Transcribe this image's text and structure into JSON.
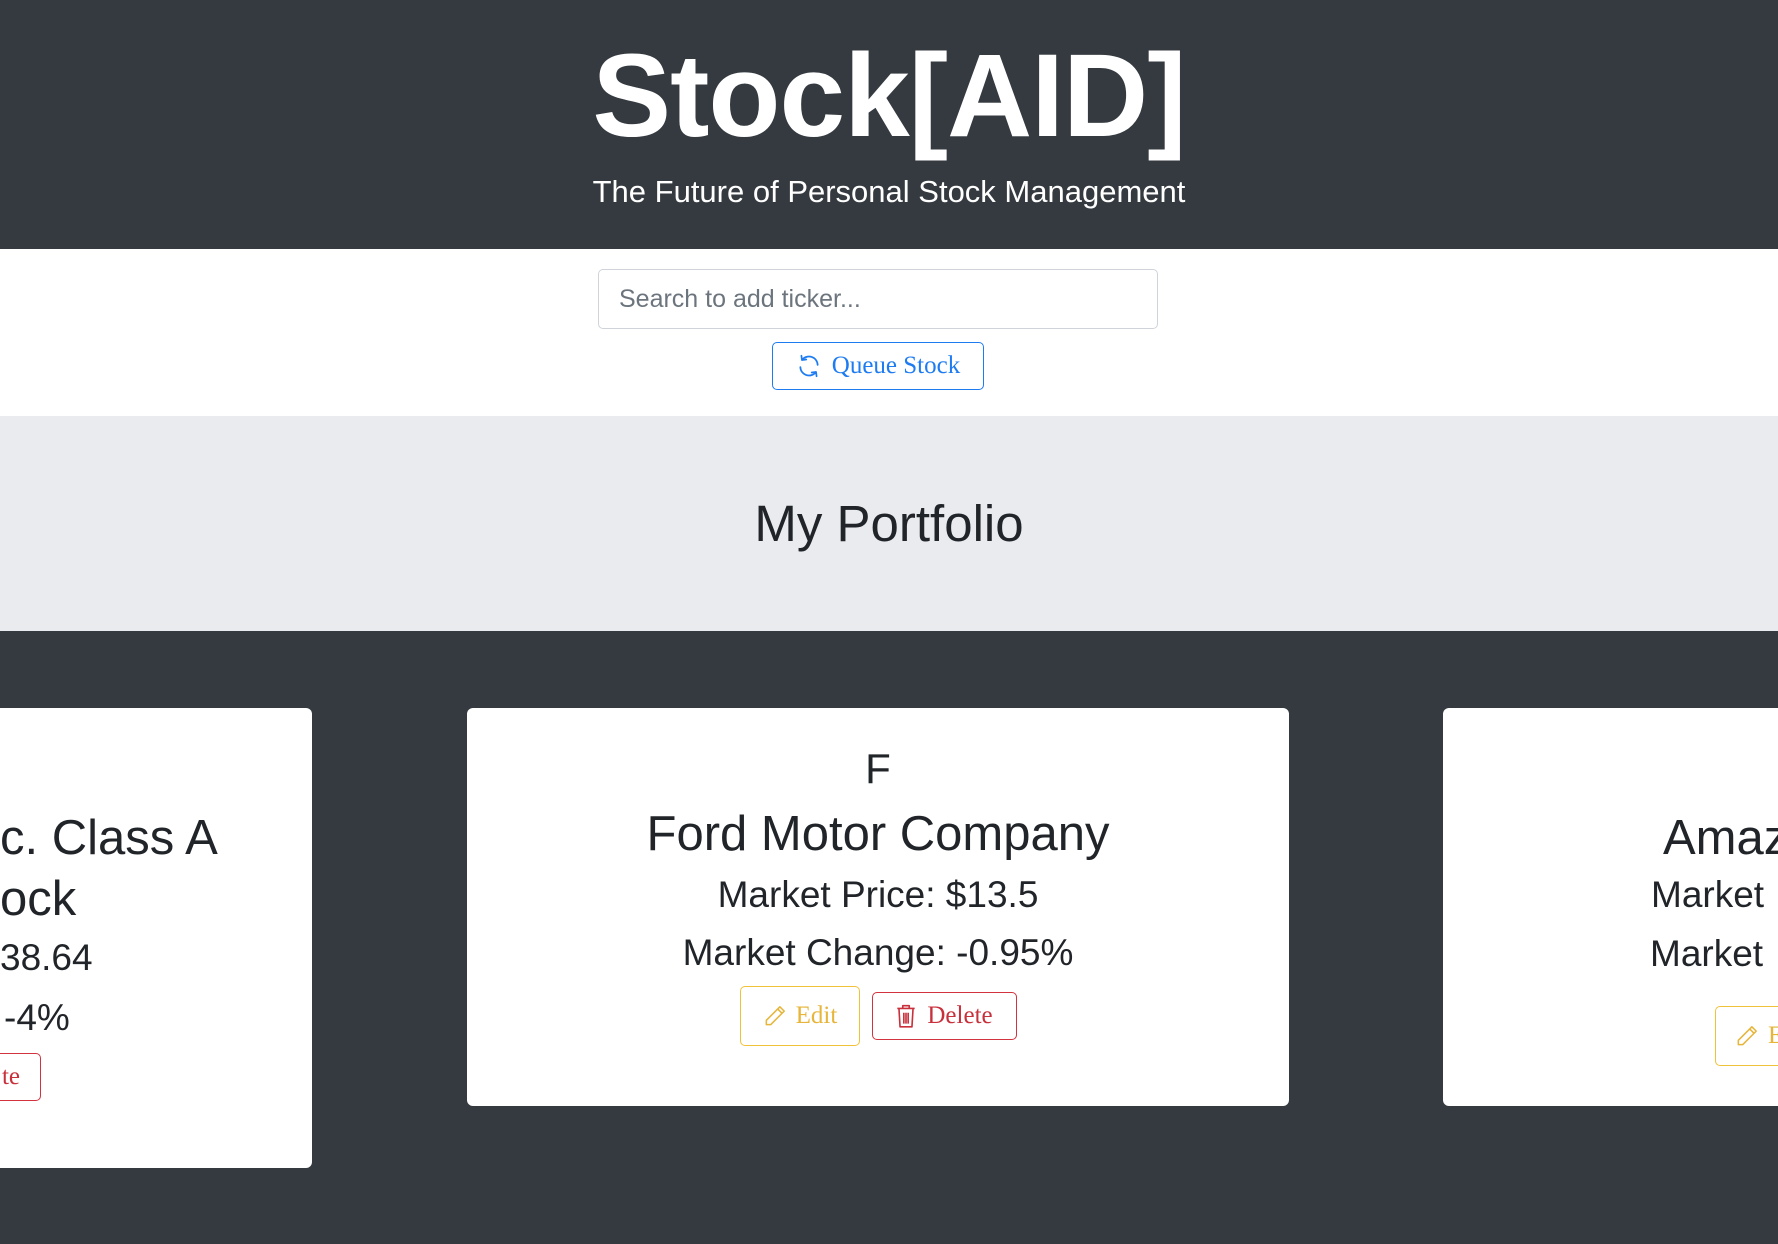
{
  "header": {
    "title": "Stock[AID]",
    "tagline": "The Future of Personal Stock Management"
  },
  "search": {
    "placeholder": "Search to add ticker...",
    "queue_label": "Queue Stock"
  },
  "portfolio": {
    "title": "My Portfolio",
    "cards": [
      {
        "ticker": "",
        "name": "c. Class A\nock",
        "price": "38.64",
        "change": "-4%",
        "edit_label": "",
        "delete_label": "te"
      },
      {
        "ticker": "F",
        "name": "Ford Motor Company",
        "price": "Market Price: $13.5",
        "change": "Market Change: -0.95%",
        "edit_label": "Edit",
        "delete_label": "Delete"
      },
      {
        "ticker": "",
        "name": "Amaz",
        "price": "Market",
        "change": "Market",
        "edit_label": "E",
        "delete_label": ""
      }
    ]
  },
  "colors": {
    "dark_bg": "#343a40",
    "band_bg": "#e9ebef",
    "primary": "#1e7cf2",
    "warning": "#e6b53a",
    "danger": "#c8303b"
  },
  "icons": {
    "queue": "refresh-icon",
    "edit": "pencil-icon",
    "delete": "trash-icon"
  }
}
